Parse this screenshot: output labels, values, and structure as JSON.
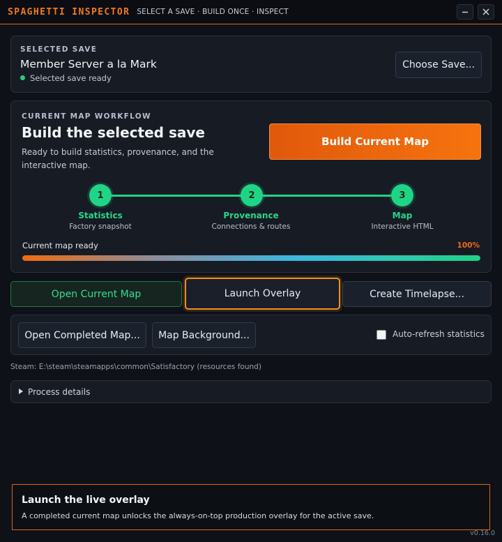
{
  "app": {
    "title": "SPAGHETTI INSPECTOR",
    "subtitle": "SELECT A SAVE · BUILD ONCE · INSPECT"
  },
  "selected_save": {
    "heading": "SELECTED SAVE",
    "name": "Member Server a la Mark",
    "status": "Selected save ready",
    "choose_button": "Choose Save..."
  },
  "workflow": {
    "heading": "CURRENT MAP WORKFLOW",
    "title": "Build the selected save",
    "description": "Ready to build statistics, provenance, and the interactive map.",
    "build_button": "Build Current Map",
    "steps": [
      {
        "number": "1",
        "title": "Statistics",
        "subtitle": "Factory snapshot"
      },
      {
        "number": "2",
        "title": "Provenance",
        "subtitle": "Connections & routes"
      },
      {
        "number": "3",
        "title": "Map",
        "subtitle": "Interactive HTML"
      }
    ],
    "progress_label": "Current map ready",
    "progress_text": "100%",
    "progress_value": 1.0
  },
  "actions": {
    "open_current_map": "Open Current Map",
    "launch_overlay": "Launch Overlay",
    "create_timelapse": "Create Timelapse..."
  },
  "secondary": {
    "open_completed_map": "Open Completed Map...",
    "map_background": "Map Background...",
    "auto_refresh_label": "Auto-refresh statistics"
  },
  "steam_path": "Steam: E:\\steam\\steamapps\\common\\Satisfactory (resources found)",
  "process_details": "Process details",
  "hint": {
    "title": "Launch the live overlay",
    "body": "A completed current map unlocks the always-on-top production overlay for the active save."
  },
  "version": "v0.16.0",
  "colors": {
    "accent_orange": "#f26b0f",
    "accent_green": "#20d486",
    "background": "#0e1117"
  }
}
